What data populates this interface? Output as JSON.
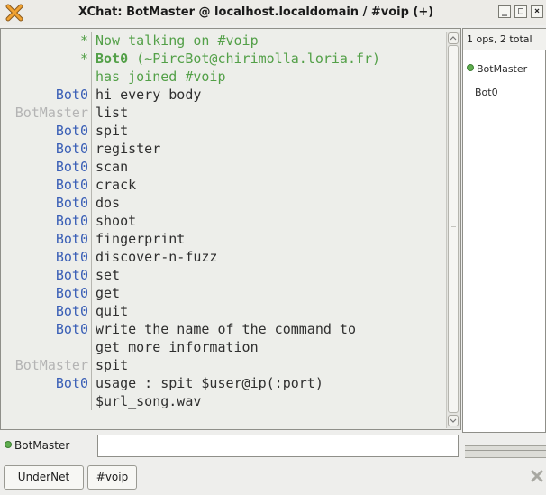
{
  "window": {
    "title": "XChat: BotMaster @ localhost.localdomain / #voip (+)",
    "buttons": {
      "minimize": "_",
      "maximize": "□",
      "close": "×"
    }
  },
  "chat": {
    "lines": [
      {
        "nick": "*",
        "kind": "sys",
        "text": "Now talking on #voip"
      },
      {
        "nick": "*",
        "kind": "sys",
        "bold": "Bot0",
        "text": " (~PircBot@chirimolla.loria.fr)"
      },
      {
        "nick": "",
        "kind": "sys",
        "text": "has joined #voip"
      },
      {
        "nick": "Bot0",
        "kind": "other",
        "text": "hi every body"
      },
      {
        "nick": "BotMaster",
        "kind": "self",
        "text": "list"
      },
      {
        "nick": "Bot0",
        "kind": "other",
        "text": "spit"
      },
      {
        "nick": "Bot0",
        "kind": "other",
        "text": "register"
      },
      {
        "nick": "Bot0",
        "kind": "other",
        "text": "scan"
      },
      {
        "nick": "Bot0",
        "kind": "other",
        "text": "crack"
      },
      {
        "nick": "Bot0",
        "kind": "other",
        "text": "dos"
      },
      {
        "nick": "Bot0",
        "kind": "other",
        "text": "shoot"
      },
      {
        "nick": "Bot0",
        "kind": "other",
        "text": "fingerprint"
      },
      {
        "nick": "Bot0",
        "kind": "other",
        "text": "discover-n-fuzz"
      },
      {
        "nick": "Bot0",
        "kind": "other",
        "text": "set"
      },
      {
        "nick": "Bot0",
        "kind": "other",
        "text": "get"
      },
      {
        "nick": "Bot0",
        "kind": "other",
        "text": "quit"
      },
      {
        "nick": "Bot0",
        "kind": "other",
        "text": "write the name of the command to"
      },
      {
        "nick": "",
        "kind": "cont",
        "text": "get more information"
      },
      {
        "nick": "BotMaster",
        "kind": "self",
        "text": "spit"
      },
      {
        "nick": "Bot0",
        "kind": "other",
        "text": "usage : spit $user@ip(:port)"
      },
      {
        "nick": "",
        "kind": "cont",
        "text": "$url_song.wav"
      }
    ]
  },
  "userlist": {
    "count": "1 ops, 2 total",
    "users": [
      {
        "name": "BotMaster",
        "op": true
      },
      {
        "name": "Bot0",
        "op": false
      }
    ]
  },
  "input": {
    "nick": "BotMaster",
    "value": ""
  },
  "tabs": [
    {
      "label": "UnderNet",
      "active": false
    },
    {
      "label": "#voip",
      "active": true
    }
  ],
  "colors": {
    "nick_other": "#3a5fb6",
    "nick_self": "#b4b4b4",
    "system": "#53a048",
    "op_dot": "#5fae4f"
  },
  "icons": {
    "app": "xchat-x-icon",
    "tab_close": "close-icon"
  }
}
